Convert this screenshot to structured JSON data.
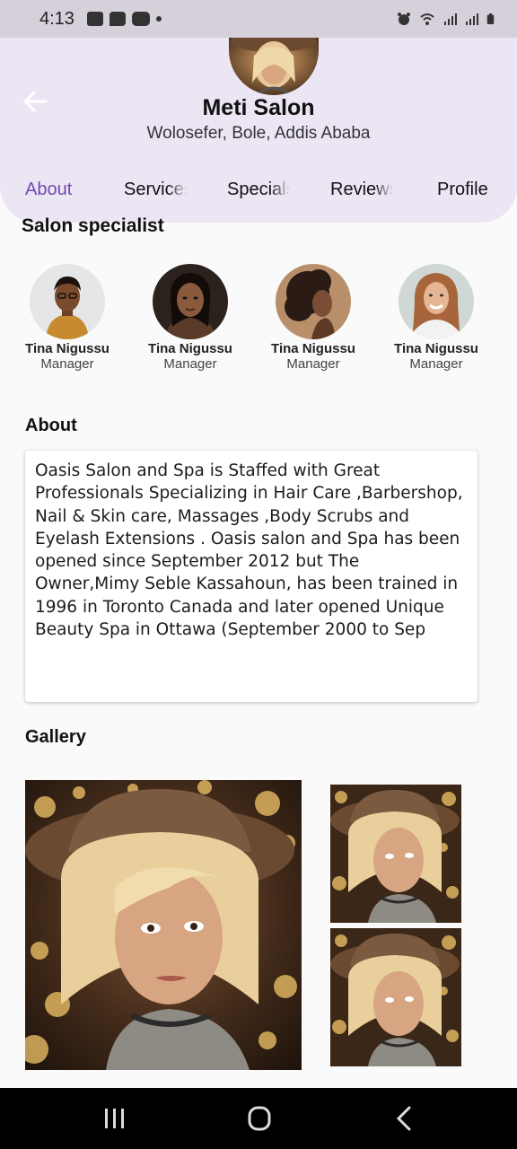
{
  "status_bar": {
    "time": "4:13"
  },
  "header": {
    "salon_name": "Meti Salon",
    "location": "Wolosefer, Bole, Addis Ababa"
  },
  "tabs": [
    {
      "label": "About",
      "active": true
    },
    {
      "label": "Services",
      "active": false
    },
    {
      "label": "Specials",
      "active": false
    },
    {
      "label": "Reviews",
      "active": false
    },
    {
      "label": "Profile",
      "active": false
    }
  ],
  "specialists": {
    "title": "Salon specialist",
    "items": [
      {
        "name": "Tina Nigussu",
        "role": "Manager"
      },
      {
        "name": "Tina Nigussu",
        "role": "Manager"
      },
      {
        "name": "Tina Nigussu",
        "role": "Manager"
      },
      {
        "name": "Tina Nigussu",
        "role": "Manager"
      }
    ]
  },
  "about": {
    "title": "About",
    "text": "Oasis Salon and Spa is Staffed with Great Professionals Specializing in Hair Care ,Barbershop, Nail & Skin care, Massages ,Body Scrubs and Eyelash Extensions . Oasis salon and Spa has been opened since September 2012 but The Owner,Mimy Seble Kassahoun, has been trained in 1996 in Toronto Canada and later opened Unique Beauty Spa in Ottawa (September 2000 to Sep"
  },
  "gallery": {
    "title": "Gallery"
  },
  "colors": {
    "accent": "#6f4bb0",
    "header_bg": "#ece6f4",
    "status_bg": "#d6d0db"
  }
}
